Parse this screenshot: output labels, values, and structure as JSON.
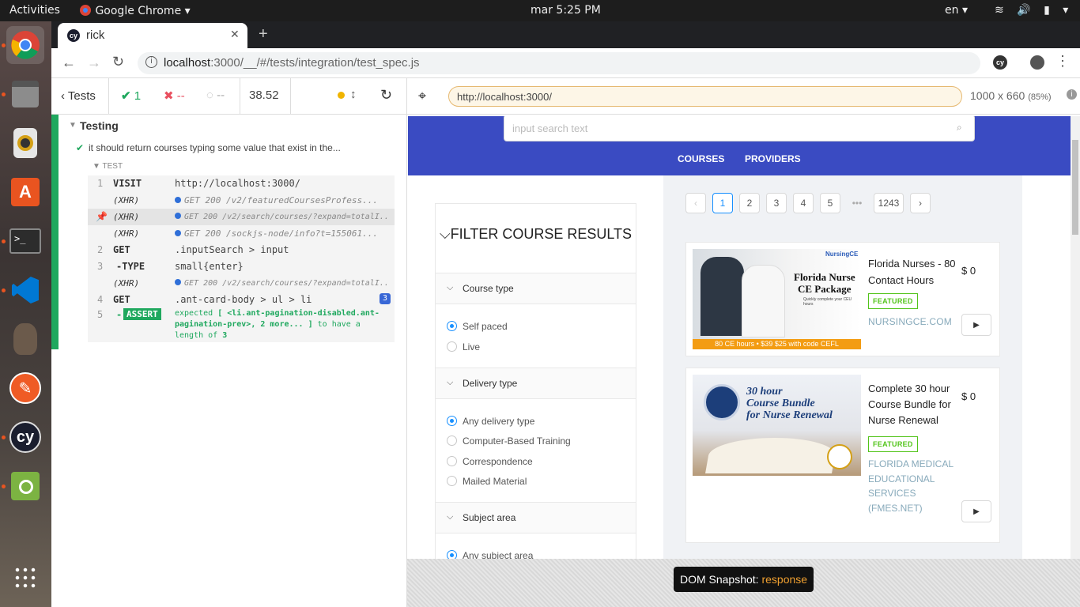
{
  "topbar": {
    "activities": "Activities",
    "app": "Google Chrome",
    "clock": "mar  5:25 PM",
    "lang": "en"
  },
  "browser": {
    "tab_title": "rick",
    "url_host": "localhost",
    "url_rest": ":3000/__/#/tests/integration/test_spec.js"
  },
  "reporter": {
    "tests_label": "Tests",
    "passed": "1",
    "failed": "--",
    "pending": "--",
    "duration": "38.52",
    "suite_title": "Testing",
    "test_title": "it should return courses typing some value that exist in the...",
    "section_label": "TEST",
    "commands": [
      {
        "n": "1",
        "name": "VISIT",
        "msg": "http://localhost:3000/"
      },
      {
        "n": "",
        "name": "(XHR)",
        "msg": "GET 200 /v2/featuredCoursesProfess..."
      },
      {
        "n": "",
        "name": "(XHR)",
        "msg": "GET 200 /v2/search/courses/?expand=totalI..."
      },
      {
        "n": "",
        "name": "(XHR)",
        "msg": "GET 200 /sockjs-node/info?t=155061..."
      },
      {
        "n": "2",
        "name": "GET",
        "msg": ".inputSearch > input"
      },
      {
        "n": "3",
        "name": "-TYPE",
        "msg": "small{enter}"
      },
      {
        "n": "",
        "name": "(XHR)",
        "msg": "GET 200 /v2/search/courses/?expand=totalI..."
      },
      {
        "n": "4",
        "name": "GET",
        "msg": ".ant-card-body > ul > li",
        "badge": "3"
      },
      {
        "n": "5",
        "name": "-ASSERT",
        "msg_pre": "expected",
        "msg_strong": "[ <li.ant-pagination-disabled.ant-pagination-prev>, 2 more... ]",
        "msg_mid": "to have a length of",
        "msg_num": "3"
      }
    ]
  },
  "aut": {
    "url": "http://localhost:3000/",
    "viewport": "1000 x 660",
    "scale": "(85%)",
    "search_placeholder": "input search text",
    "nav": [
      "COURSES",
      "PROVIDERS"
    ],
    "filter_title": "FILTER COURSE RESULTS",
    "filters": [
      {
        "title": "Course type",
        "options": [
          "Self paced",
          "Live"
        ]
      },
      {
        "title": "Delivery type",
        "options": [
          "Any delivery type",
          "Computer-Based Training",
          "Correspondence",
          "Mailed Material"
        ]
      },
      {
        "title": "Subject area",
        "options": [
          "Any subject area"
        ]
      }
    ],
    "pagination": [
      "1",
      "2",
      "3",
      "4",
      "5",
      "•••",
      "1243"
    ],
    "courses": [
      {
        "title": "Florida Nurses - 80 Contact Hours",
        "price": "$ 0",
        "badge": "FEATURED",
        "provider": "NURSINGCE.COM",
        "img_line1": "Florida Nurse",
        "img_line2": "CE Package",
        "img_sub": "Quickly complete your CEU hours",
        "img_foot": "80 CE hours • $39 $25 with code CEFL",
        "img_brand": "NursingCE"
      },
      {
        "title": "Complete 30 hour Course Bundle for Nurse Renewal",
        "price": "$ 0",
        "badge": "FEATURED",
        "provider": "FLORIDA MEDICAL EDUCATIONAL SERVICES (FMES.NET)",
        "img_line1": "30 hour",
        "img_line2": "Course Bundle",
        "img_line3": "for Nurse Renewal"
      }
    ],
    "snapshot_label": "DOM Snapshot:",
    "snapshot_state": "response"
  },
  "colors": {
    "header_blue": "#3a4bc2",
    "pass_green": "#1fa85e",
    "fail_red": "#e94f5f",
    "link_blue": "#1890ff"
  }
}
